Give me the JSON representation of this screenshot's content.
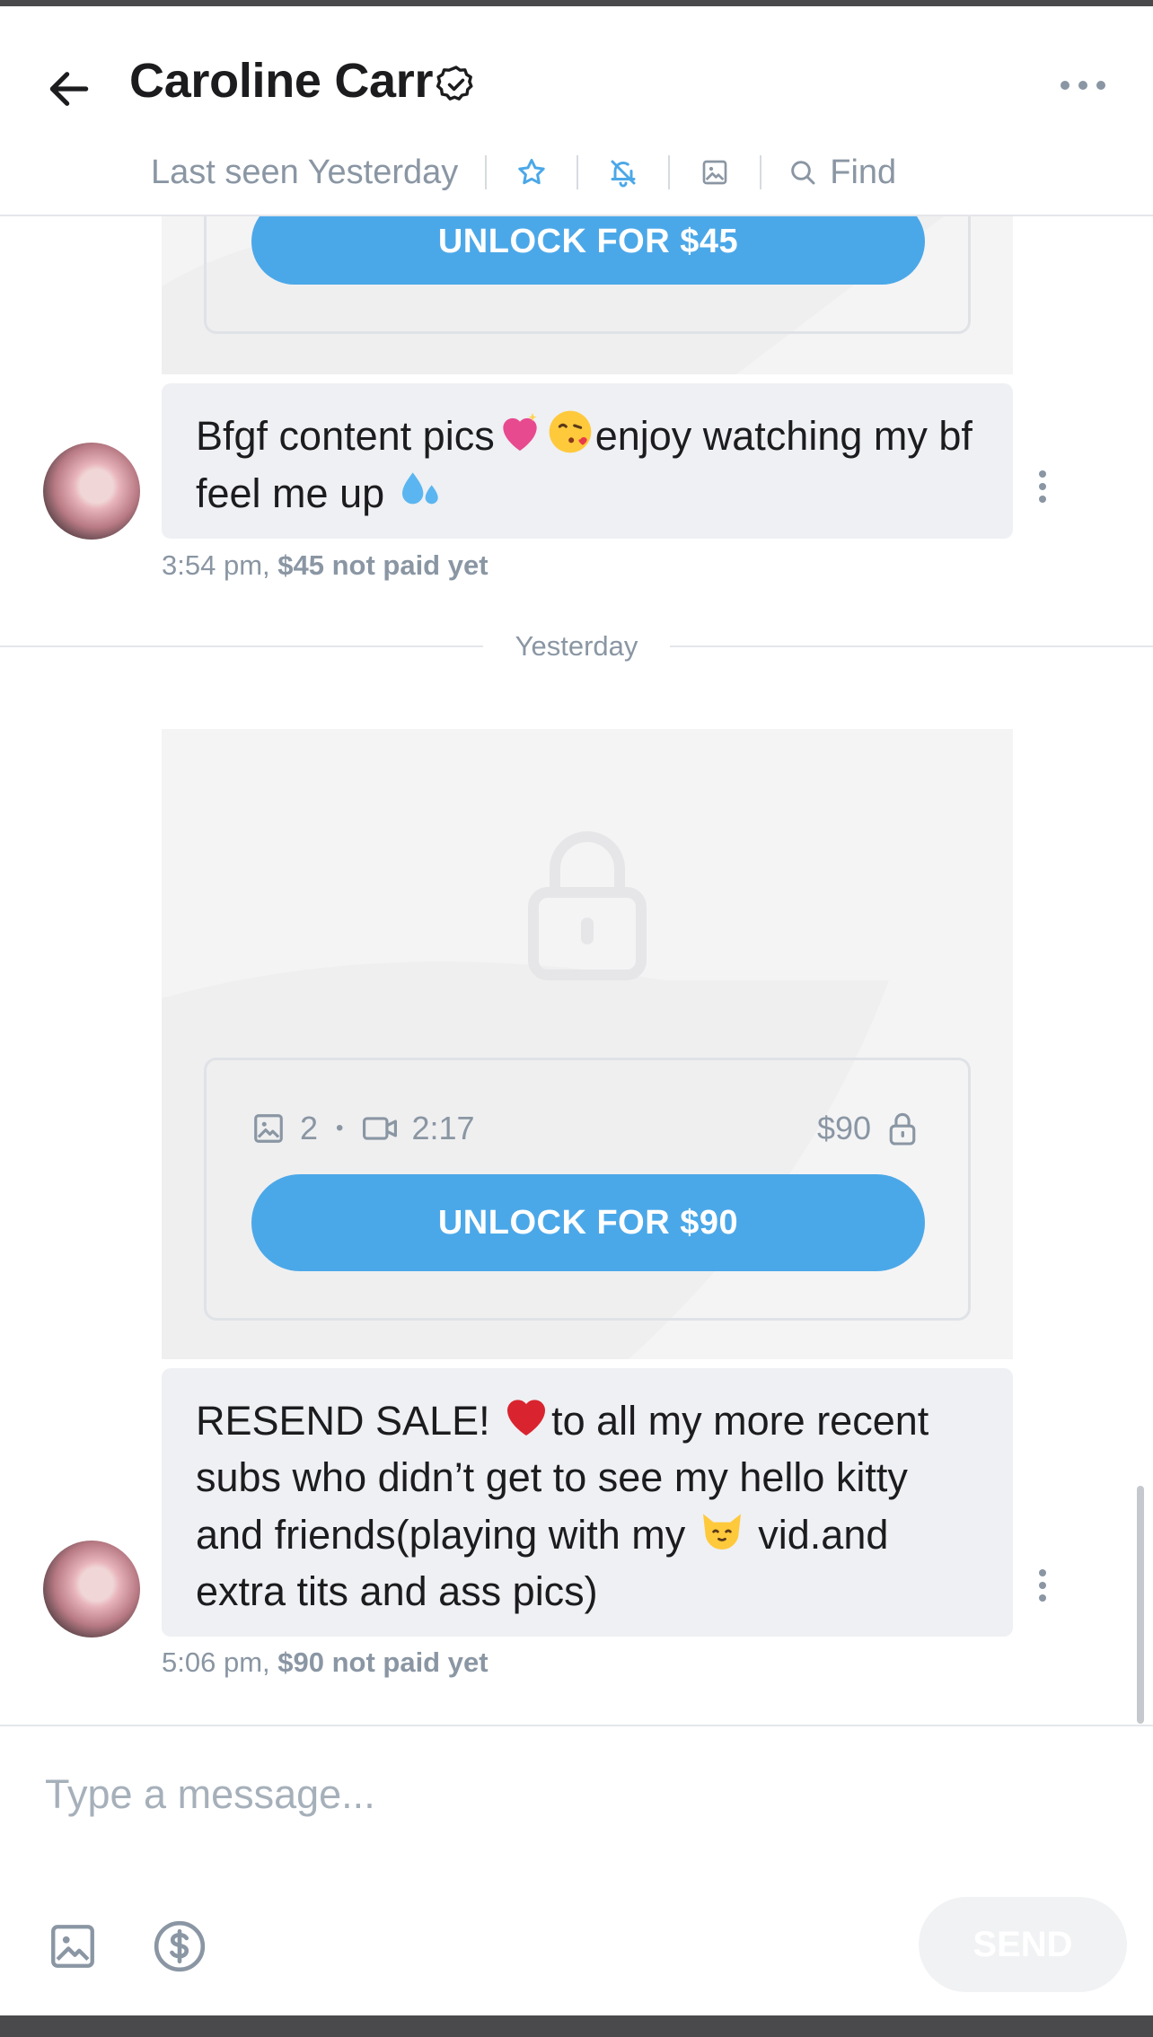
{
  "header": {
    "title": "Caroline Carr",
    "status": "Last seen Yesterday",
    "find_label": "Find"
  },
  "messages": [
    {
      "unlock_label": "UNLOCK FOR $45",
      "text_before": "Bfgf content pics",
      "text_after": "enjoy watching my bf feel me up ",
      "time": "3:54 pm,",
      "payment_status": "$45 not paid yet"
    },
    {
      "media_photos": "2",
      "media_video_duration": "2:17",
      "price": "$90",
      "unlock_label": "UNLOCK FOR $90",
      "text_line1_before": "RESEND SALE! ",
      "text_line1_after": "to all my more recent subs who didn’t get to see my hello kitty and friends(playing with my ",
      "text_line1_end": " vid.and extra tits and ass pics)",
      "time": "5:06 pm,",
      "payment_status": "$90 not paid yet"
    }
  ],
  "day_divider": "Yesterday",
  "composer": {
    "placeholder": "Type a message...",
    "send_label": "SEND"
  },
  "colors": {
    "accent": "#4ba8e8",
    "muted": "#8a96a3",
    "bubble": "#eef0f3",
    "card": "#f4f4f5"
  },
  "icons": [
    "back-arrow-icon",
    "verified-badge-icon",
    "more-horizontal-icon",
    "star-icon",
    "bell-off-icon",
    "image-icon",
    "search-icon",
    "lock-icon",
    "photo-icon",
    "video-icon",
    "kebab-icon",
    "dollar-icon"
  ]
}
